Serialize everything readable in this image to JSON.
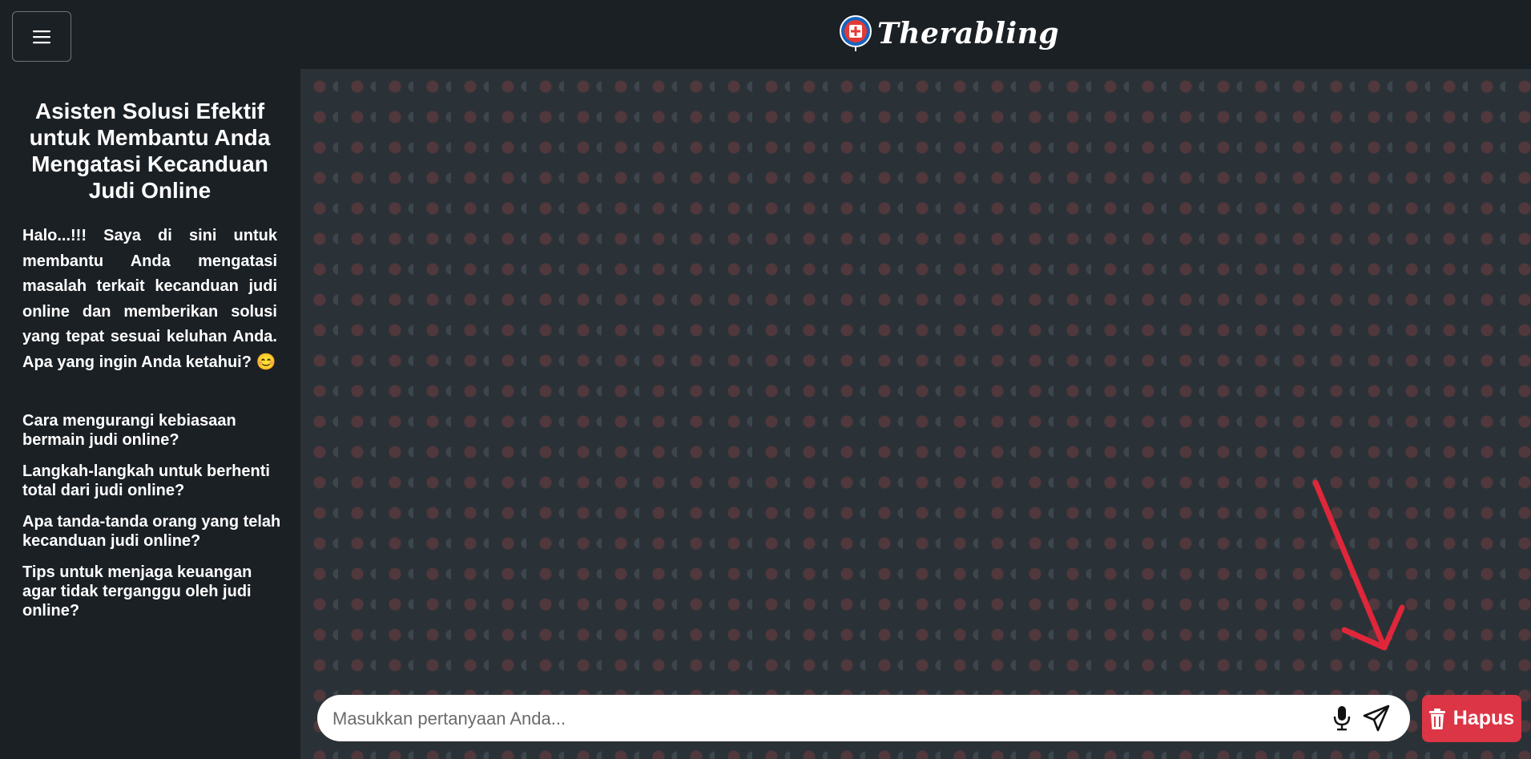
{
  "header": {
    "menu_icon": "hamburger-icon",
    "brand_name": "Therabling",
    "logo_icon": "therabling-logo-icon"
  },
  "sidebar": {
    "title": "Asisten Solusi Efektif untuk Membantu Anda Mengatasi Kecanduan Judi Online",
    "intro": "Halo...!!! Saya di sini untuk membantu Anda mengatasi masalah terkait kecanduan judi online dan memberikan solusi yang tepat sesuai keluhan Anda. Apa yang ingin Anda ketahui? 😊",
    "suggestions": [
      "Cara mengurangi kebiasaan bermain judi online?",
      "Langkah-langkah untuk berhenti total dari judi online?",
      "Apa tanda-tanda orang yang telah kecanduan judi online?",
      "Tips untuk menjaga keuangan agar tidak terganggu oleh judi online?"
    ]
  },
  "chat": {
    "input_placeholder": "Masukkan pertanyaan Anda...",
    "input_value": "",
    "mic_icon": "microphone-icon",
    "send_icon": "send-icon",
    "delete_label": "Hapus",
    "delete_icon": "trash-icon"
  },
  "colors": {
    "background": "#1b2025",
    "chat_background": "#2b3237",
    "delete_button": "#dc3545",
    "annotation_arrow": "#e0263a"
  }
}
